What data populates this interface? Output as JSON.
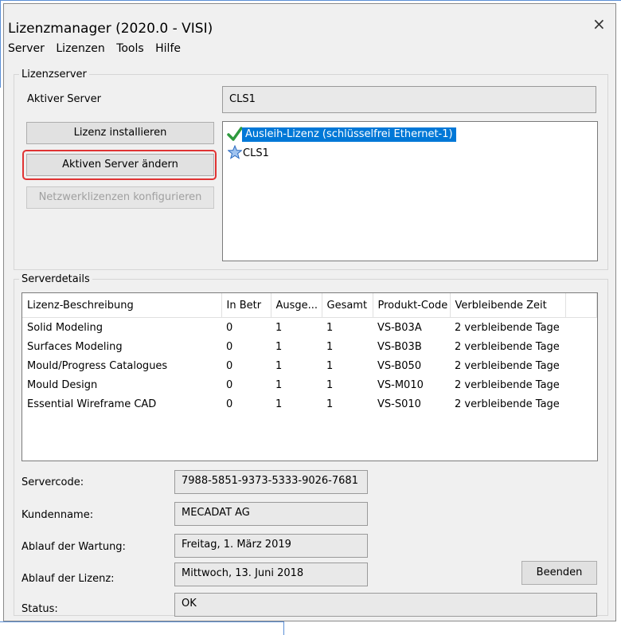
{
  "window": {
    "title": "Lizenzmanager (2020.0 - VISI)",
    "close_label": "×"
  },
  "menu": [
    "Server",
    "Lizenzen",
    "Tools",
    "Hilfe"
  ],
  "lizenzserver": {
    "legend": "Lizenzserver",
    "active_label": "Aktiver Server",
    "active_value": "CLS1",
    "buttons": {
      "install": "Lizenz installieren",
      "change": "Aktiven Server ändern",
      "configure": "Netzwerklizenzen konfigurieren"
    },
    "tree": [
      {
        "label": "Ausleih-Lizenz (schlüsselfrei Ethernet-1)",
        "icon": "checkmark-icon",
        "selected": true
      },
      {
        "label": "CLS1",
        "icon": "star-icon",
        "selected": false
      }
    ]
  },
  "serverdetails": {
    "legend": "Serverdetails",
    "columns": [
      "Lizenz-Beschreibung",
      "In Betr",
      "Ausge...",
      "Gesamt",
      "Produkt-Code",
      "Verbleibende Zeit"
    ],
    "rows": [
      [
        "Solid Modeling",
        "0",
        "1",
        "1",
        "VS-B03A",
        "2 verbleibende Tage"
      ],
      [
        "Surfaces Modeling",
        "0",
        "1",
        "1",
        "VS-B03B",
        "2 verbleibende Tage"
      ],
      [
        "Mould/Progress Catalogues",
        "0",
        "1",
        "1",
        "VS-B050",
        "2 verbleibende Tage"
      ],
      [
        "Mould Design",
        "0",
        "1",
        "1",
        "VS-M010",
        "2 verbleibende Tage"
      ],
      [
        "Essential Wireframe CAD",
        "0",
        "1",
        "1",
        "VS-S010",
        "2 verbleibende Tage"
      ]
    ],
    "fields": {
      "servercode": {
        "label": "Servercode:",
        "value": "7988-5851-9373-5333-9026-7681"
      },
      "kundenname": {
        "label": "Kundenname:",
        "value": "MECADAT AG"
      },
      "wartung": {
        "label": "Ablauf der Wartung:",
        "value": "Freitag, 1. März 2019"
      },
      "lizenz": {
        "label": "Ablauf der Lizenz:",
        "value": "Mittwoch, 13. Juni 2018"
      },
      "status": {
        "label": "Status:",
        "value": "OK"
      }
    },
    "close_button": "Beenden"
  },
  "colors": {
    "selection": "#0078d7",
    "highlight": "#e03333"
  }
}
